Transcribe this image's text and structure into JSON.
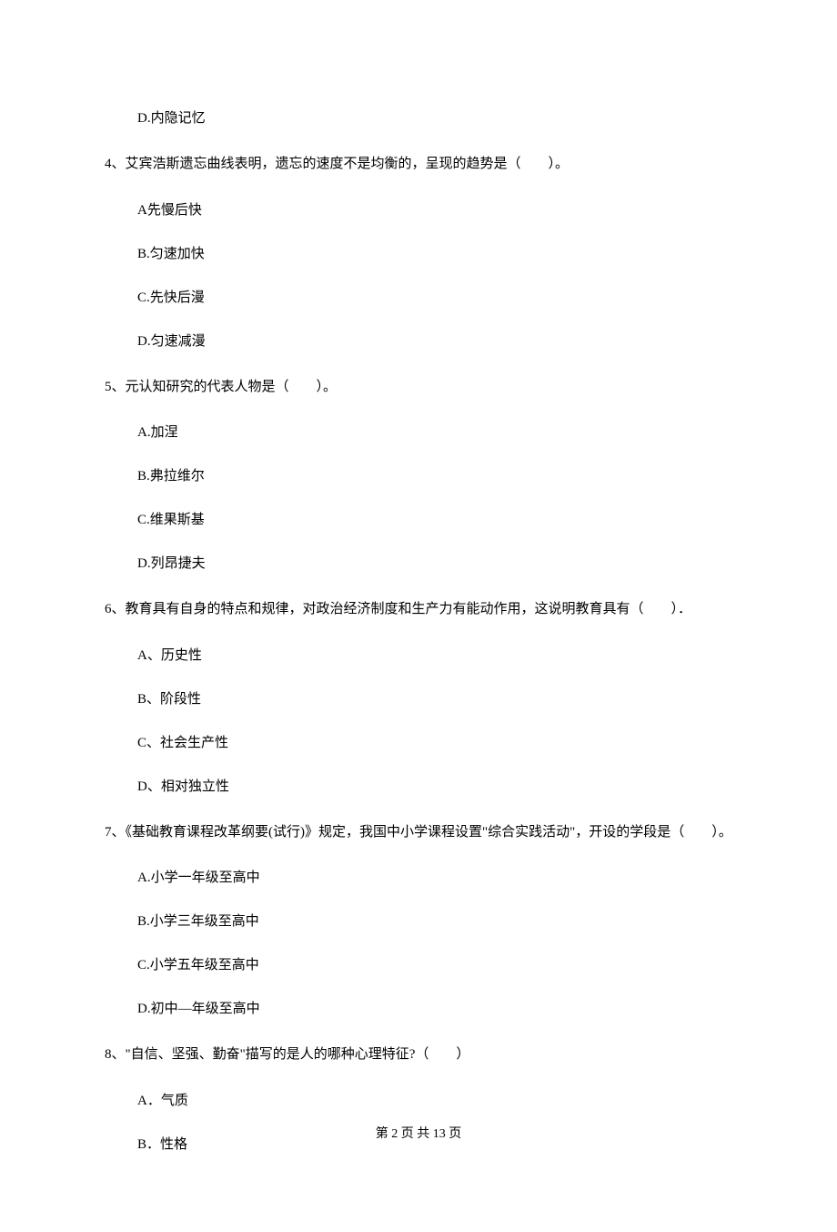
{
  "leading_option": "D.内隐记忆",
  "questions": [
    {
      "num": "4、",
      "text": "艾宾浩斯遗忘曲线表明，遗忘的速度不是均衡的，呈现的趋势是（　　）。",
      "options": [
        "A先慢后快",
        "B.匀速加快",
        "C.先快后漫",
        "D.匀速减漫"
      ]
    },
    {
      "num": "5、",
      "text": "元认知研究的代表人物是（　　）。",
      "options": [
        "A.加涅",
        "B.弗拉维尔",
        "C.维果斯基",
        "D.列昂捷夫"
      ]
    },
    {
      "num": "6、",
      "text": "教育具有自身的特点和规律，对政治经济制度和生产力有能动作用，这说明教育具有（　　）．",
      "options": [
        "A、历史性",
        "B、阶段性",
        "C、社会生产性",
        "D、相对独立性"
      ]
    },
    {
      "num": "7、",
      "text": "《基础教育课程改革纲要(试行)》规定，我国中小学课程设置\"综合实践活动\"，开设的学段是（　　）。",
      "options": [
        "A.小学一年级至高中",
        "B.小学三年级至高中",
        "C.小学五年级至高中",
        "D.初中—年级至高中"
      ]
    },
    {
      "num": "8、",
      "text": "\"自信、坚强、勤奋\"描写的是人的哪种心理特征?（　　）",
      "options": [
        "A．气质",
        "B．性格"
      ]
    }
  ],
  "footer": "第 2 页 共 13 页"
}
